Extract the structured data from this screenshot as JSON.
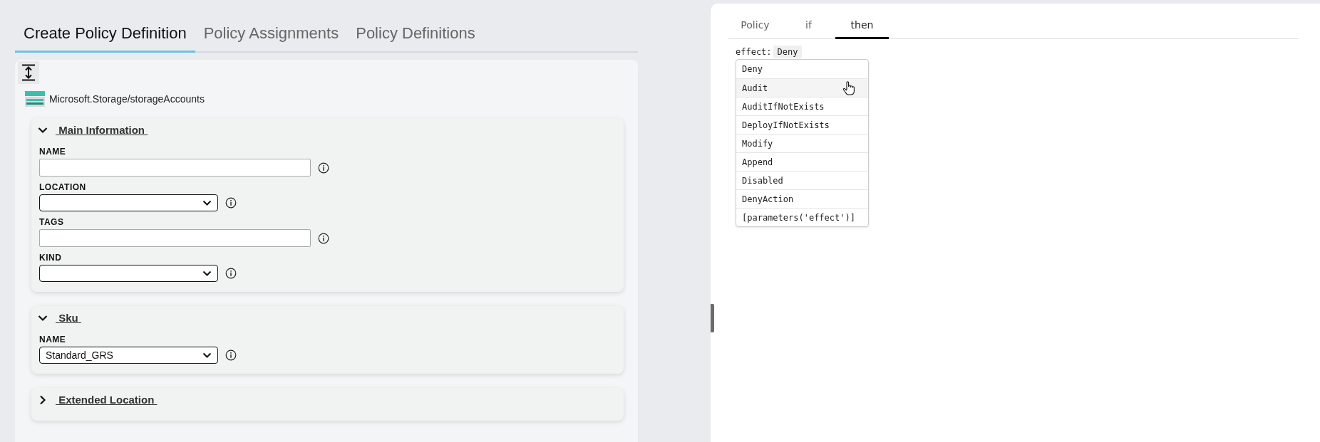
{
  "tabs": [
    {
      "label": "Create Policy Definition",
      "selected": true
    },
    {
      "label": "Policy Assignments",
      "selected": false
    },
    {
      "label": "Policy Definitions",
      "selected": false
    }
  ],
  "resource": {
    "label": "Microsoft.Storage/storageAccounts"
  },
  "sections": [
    {
      "title": "Main Information",
      "expanded": true,
      "fields": [
        {
          "label": "NAME",
          "kind": "text"
        },
        {
          "label": "LOCATION",
          "kind": "select"
        },
        {
          "label": "TAGS",
          "kind": "text"
        },
        {
          "label": "KIND",
          "kind": "select"
        }
      ]
    },
    {
      "title": "Sku",
      "expanded": true,
      "fields": [
        {
          "label": "NAME",
          "kind": "select",
          "value": "Standard_GRS"
        }
      ]
    },
    {
      "title": "Extended Location",
      "expanded": false
    }
  ],
  "right_panel": {
    "tabs": [
      {
        "label": "Policy",
        "selected": false
      },
      {
        "label": "if",
        "selected": false
      },
      {
        "label": "then",
        "selected": true
      }
    ],
    "effect": {
      "key": "effect:",
      "value": "Deny"
    },
    "options": [
      {
        "label": "Deny",
        "hovered": false
      },
      {
        "label": "Audit",
        "hovered": true
      },
      {
        "label": "AuditIfNotExists",
        "hovered": false
      },
      {
        "label": "DeployIfNotExists",
        "hovered": false
      },
      {
        "label": "Modify",
        "hovered": false
      },
      {
        "label": "Append",
        "hovered": false
      },
      {
        "label": "Disabled",
        "hovered": false
      },
      {
        "label": "DenyAction",
        "hovered": false
      },
      {
        "label": "[parameters('effect')]",
        "hovered": false
      }
    ]
  }
}
